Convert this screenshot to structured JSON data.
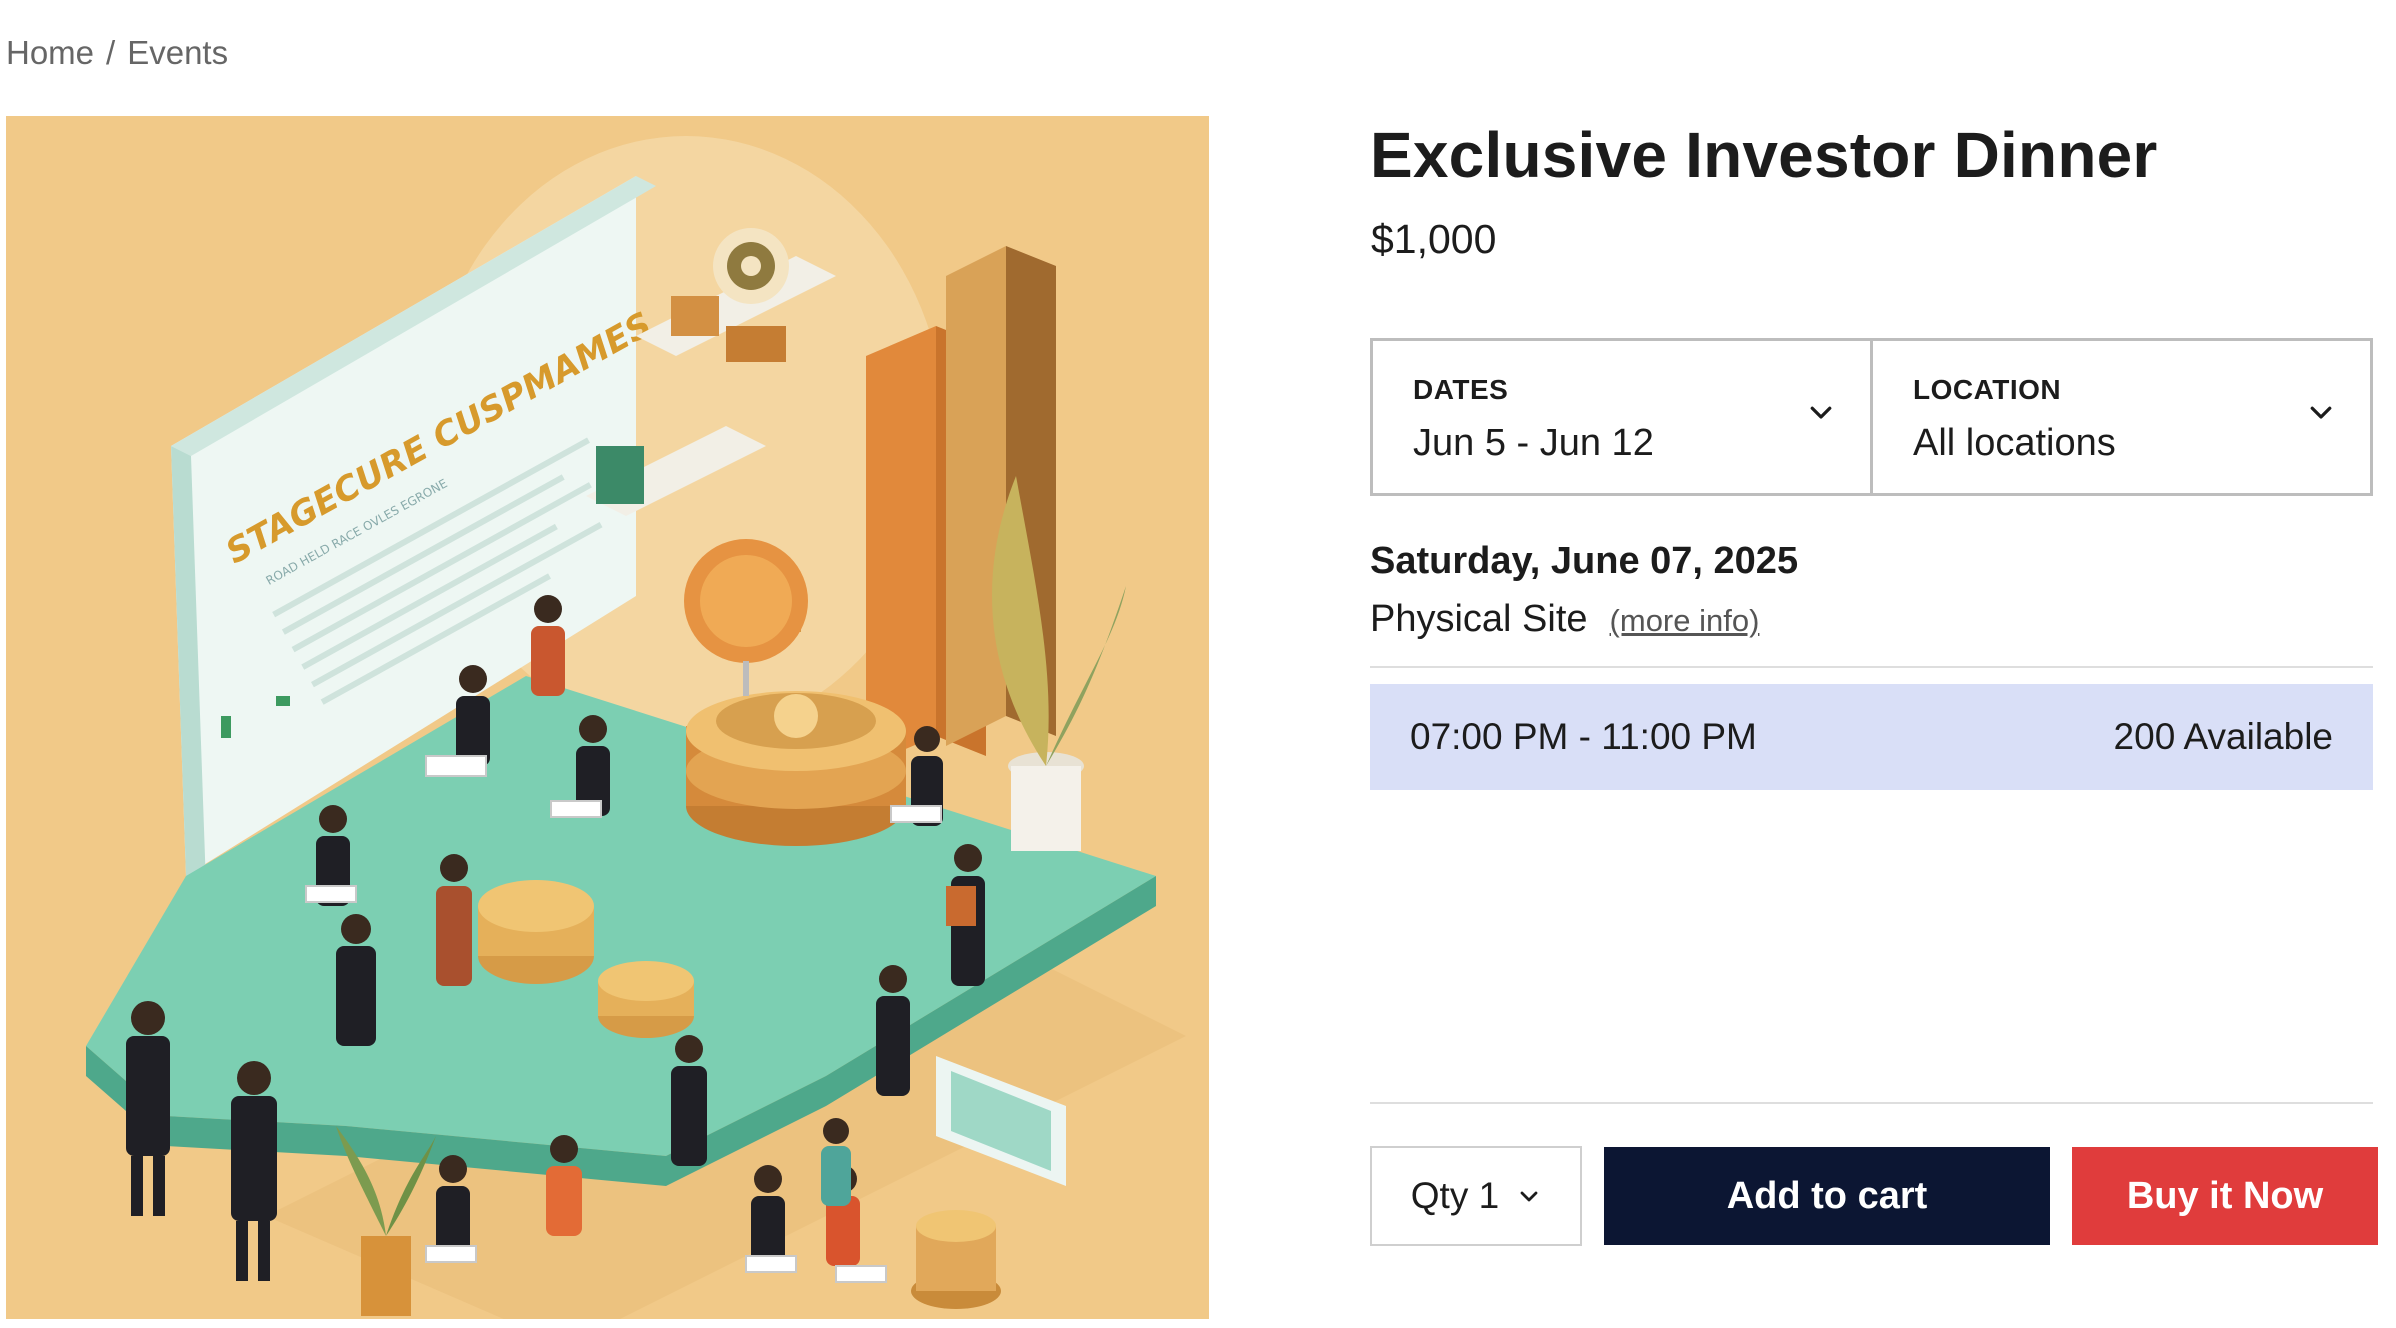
{
  "breadcrumb": {
    "home": "Home",
    "separator": "/",
    "current": "Events"
  },
  "product": {
    "title": "Exclusive Investor Dinner",
    "price": "$1,000"
  },
  "hero_image": {
    "alt": "Illustration of investors networking at an event",
    "sign_text": "STAGECURE CUSPMAMES",
    "sign_subtext": "ROAD HELD RACE OVLES EGRONE"
  },
  "selectors": {
    "dates": {
      "label": "DATES",
      "value": "Jun 5 - Jun 12",
      "icon": "chevron-down-icon"
    },
    "location": {
      "label": "LOCATION",
      "value": "All locations",
      "icon": "chevron-down-icon"
    }
  },
  "event": {
    "date": "Saturday, June 07, 2025",
    "site": "Physical Site",
    "more_info": "(more info)"
  },
  "slot": {
    "time": "07:00 PM - 11:00 PM",
    "availability": "200 Available"
  },
  "actions": {
    "qty_label": "Qty 1",
    "add_to_cart": "Add to cart",
    "buy_now": "Buy it Now"
  },
  "colors": {
    "cart_button": "#0c1633",
    "buy_button": "#e03c3c",
    "slot_highlight": "#d9dff7",
    "hero_background": "#f1c988",
    "platform_teal": "#7ccfb2"
  }
}
